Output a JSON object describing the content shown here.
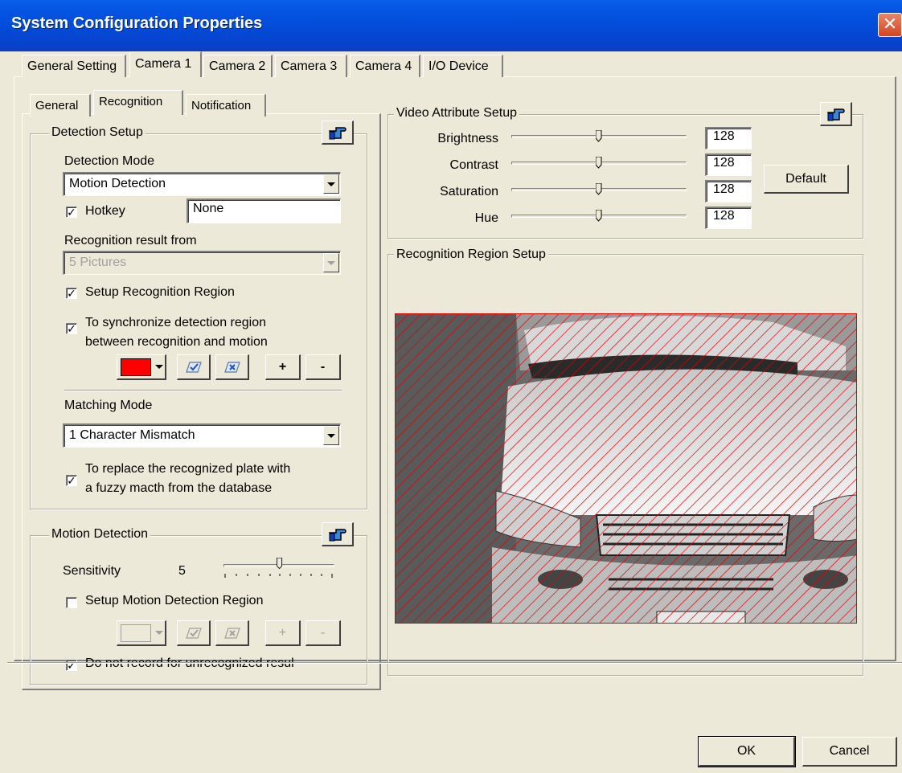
{
  "window": {
    "title": "System Configuration Properties",
    "close_glyph": "✕"
  },
  "main_tabs": [
    {
      "label": "General Setting",
      "active": false
    },
    {
      "label": "Camera 1",
      "active": true
    },
    {
      "label": "Camera 2",
      "active": false
    },
    {
      "label": "Camera 3",
      "active": false
    },
    {
      "label": "Camera 4",
      "active": false
    },
    {
      "label": "I/O Device",
      "active": false
    }
  ],
  "sub_tabs": [
    {
      "label": "General",
      "active": false
    },
    {
      "label": "Recognition",
      "active": true
    },
    {
      "label": "Notification",
      "active": false
    }
  ],
  "detection_setup": {
    "title": "Detection Setup",
    "mode_label": "Detection Mode",
    "mode_value": "Motion Detection",
    "hotkey_label": "Hotkey",
    "hotkey_checked": true,
    "hotkey_value": "None",
    "result_from_label": "Recognition result from",
    "result_from_value": "5 Pictures",
    "setup_region_label": "Setup Recognition Region",
    "setup_region_checked": true,
    "sync_label_1": "To synchronize detection region",
    "sync_label_2": "between recognition and motion",
    "sync_checked": true,
    "region_color": "#ff0000",
    "plus_label": "+",
    "minus_label": "-",
    "matching_label": "Matching Mode",
    "matching_value": "1 Character Mismatch",
    "fuzzy_label_1": "To replace the recognized plate with",
    "fuzzy_label_2": "a fuzzy macth from the database",
    "fuzzy_checked": true
  },
  "motion_detection": {
    "title": "Motion Detection",
    "sensitivity_label": "Sensitivity",
    "sensitivity_value": "5",
    "setup_region_label": "Setup Motion Detection Region",
    "setup_region_checked": false,
    "plus_label": "+",
    "minus_label": "-",
    "no_record_label": "Do not record for unrecognized resul",
    "no_record_checked": true
  },
  "video_attributes": {
    "title": "Video Attribute Setup",
    "items": [
      {
        "label": "Brightness",
        "value": "128",
        "level": 0.5
      },
      {
        "label": "Contrast",
        "value": "128",
        "level": 0.5
      },
      {
        "label": "Saturation",
        "value": "128",
        "level": 0.5
      },
      {
        "label": "Hue",
        "value": "128",
        "level": 0.5
      }
    ],
    "default_label": "Default"
  },
  "region_setup": {
    "title": "Recognition Region Setup"
  },
  "footer": {
    "ok_label": "OK",
    "cancel_label": "Cancel"
  }
}
